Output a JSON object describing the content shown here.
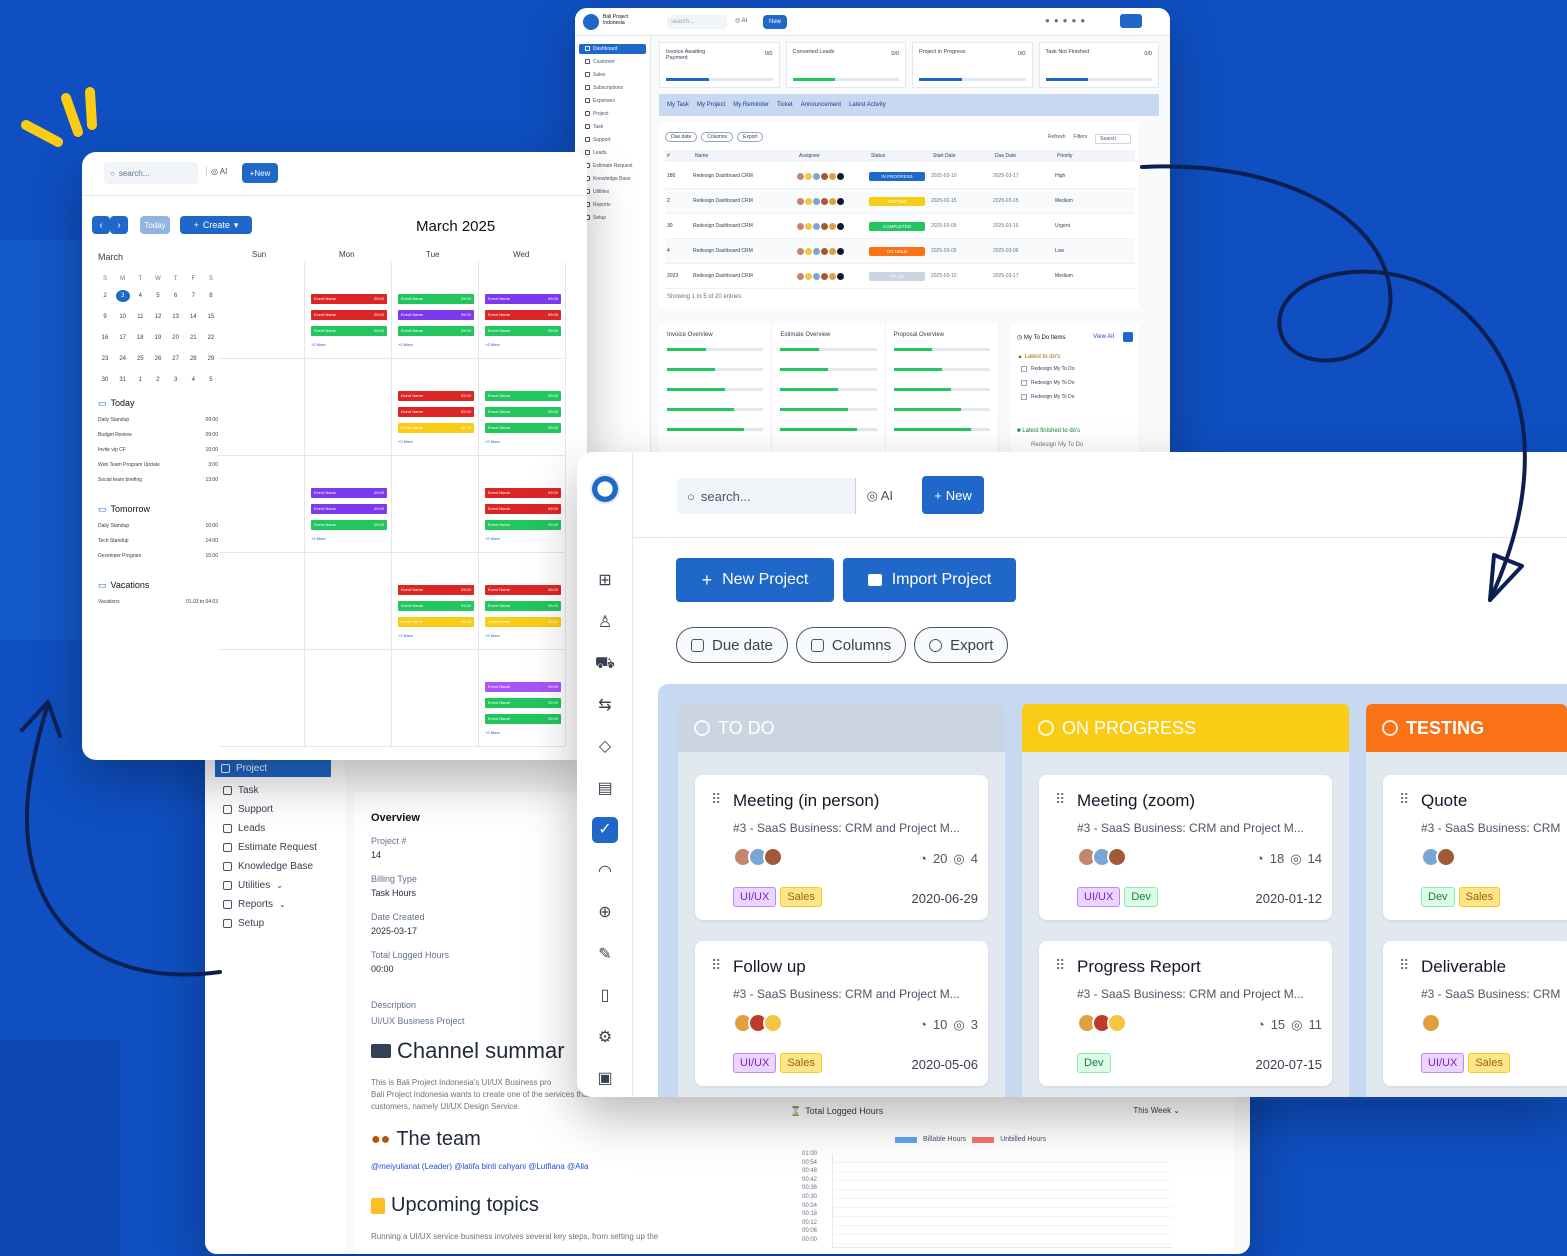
{
  "colors": {
    "background": "#0f4fc1",
    "accent": "#1f67c8",
    "todo": "#cbd5e1",
    "on_progress": "#facc15",
    "testing": "#f97316"
  },
  "report": {
    "nav": [
      {
        "label": "Project",
        "icon": "project-icon",
        "active": true
      },
      {
        "label": "Task",
        "icon": "task-icon"
      },
      {
        "label": "Support",
        "icon": "headset-icon"
      },
      {
        "label": "Leads",
        "icon": "target-icon"
      },
      {
        "label": "Estimate Request",
        "icon": "estimate-icon"
      },
      {
        "label": "Knowledge Base",
        "icon": "book-icon"
      },
      {
        "label": "Utilities",
        "icon": "utilities-icon",
        "chevron": true
      },
      {
        "label": "Reports",
        "icon": "reports-icon",
        "chevron": true
      },
      {
        "label": "Setup",
        "icon": "gear-icon"
      }
    ],
    "overview": {
      "title": "Overview",
      "project_no_label": "Project #",
      "project_no": "14",
      "billing_label": "Billing Type",
      "billing": "Task Hours",
      "date_label": "Date Created",
      "date": "2025-03-17",
      "hours_label": "Total Logged Hours",
      "hours": "00:00",
      "desc_label": "Description",
      "desc": "UI/UX Business Project"
    },
    "channel_heading": "Channel summar",
    "channel_text_1": "This is Bali Project Indonesia's UI/UX Business pro",
    "channel_text_2": "Bali Project Indonesia wants to create one of the services that we will offer to",
    "channel_text_3": "customers, namely UI/UX Design Service.",
    "team_heading": "The team",
    "team_line": "@meiyulianat (Leader) @latifa binti cahyani @Lutfiana @Alia",
    "topics_heading": "Upcoming topics",
    "topics_text": "Running a UI/UX service business involves several key steps, from setting up the",
    "chart": {
      "title": "Total Logged Hours",
      "range": "This Week",
      "legend": [
        "Billable Hours",
        "Unbilled Hours"
      ],
      "yticks": [
        "01:00",
        "00:54",
        "00:48",
        "00:42",
        "00:36",
        "00:30",
        "00:24",
        "00:18",
        "00:12",
        "00:06",
        "00:00"
      ]
    }
  },
  "dashboard": {
    "brand": "Bali Project Indonesia",
    "search": "search...",
    "ai": "AI",
    "new": "New",
    "nav": [
      "Dashboard",
      "Customer",
      "Sales",
      "Subscriptions",
      "Expenses",
      "Project",
      "Task",
      "Support",
      "Leads",
      "Estimate Request",
      "Knowledge Base",
      "Utilities",
      "Reports",
      "Setup"
    ],
    "stats": [
      {
        "label": "Invoice Awaiting Payment",
        "value": "0/0"
      },
      {
        "label": "Converted Leads",
        "value": "0/0"
      },
      {
        "label": "Project in Progress",
        "value": "0/0"
      },
      {
        "label": "Task Not Finished",
        "value": "0/0"
      }
    ],
    "tabs": [
      "My Task",
      "My Project",
      "My Reminder",
      "Ticket",
      "Announcement",
      "Latest Activity"
    ],
    "filters": [
      "Due date",
      "Columns",
      "Export"
    ],
    "table_actions": [
      "Refresh",
      "Filters",
      "Search"
    ],
    "columns": [
      "#",
      "Name",
      "Assignee",
      "Status",
      "Start Date",
      "Due Date",
      "Priority"
    ],
    "rows": [
      {
        "num": "180",
        "name": "Redesign Dashboard CRM",
        "status": "IN PROGRESS",
        "status_color": "#1f67c8",
        "start": "2025-03-10",
        "due": "2025-03-17",
        "priority": "High"
      },
      {
        "num": "2",
        "name": "Redesign Dashboard CRM",
        "status": "TESTING",
        "status_color": "#facc15",
        "start": "2025-02-15",
        "due": "2025-03-15",
        "priority": "Medium"
      },
      {
        "num": "30",
        "name": "Redesign Dashboard CRM",
        "status": "COMPLETED",
        "status_color": "#22c55e",
        "start": "2025-03-05",
        "due": "2025-03-15",
        "priority": "Urgent"
      },
      {
        "num": "4",
        "name": "Redesign Dashboard CRM",
        "status": "ON HOLD",
        "status_color": "#f97316",
        "start": "2025-03-05",
        "due": "2025-03-06",
        "priority": "Low"
      },
      {
        "num": "2023",
        "name": "Redesign Dashboard CRM",
        "status": "TO DO",
        "status_color": "#cbd5e1",
        "start": "2025-03-10",
        "due": "2025-03-17",
        "priority": "Medium"
      }
    ],
    "showing": "Showing 1 to 5 of 20 entries",
    "overviews": [
      "Invoice Overview",
      "Estimate Overview",
      "Proposal Overview"
    ],
    "todo_title": "My To Do Items",
    "todo_view": "View All",
    "todo_latest": "Latest to do's",
    "todo_done": "Latest finished to do's",
    "todo_item": "Redesign My To Do"
  },
  "calendar": {
    "search": "search...",
    "ai": "AI",
    "new": "New",
    "today_btn": "Today",
    "create_btn": "Create",
    "title": "March 2025",
    "days": [
      "Sun",
      "Mon",
      "Tue",
      "Wed"
    ],
    "mini_month": "March",
    "mini_weekdays": [
      "S",
      "M",
      "T",
      "W",
      "T",
      "F",
      "S"
    ],
    "mini_rows": [
      [
        "2",
        "3",
        "4",
        "5",
        "6",
        "7",
        "8"
      ],
      [
        "9",
        "10",
        "11",
        "12",
        "13",
        "14",
        "15"
      ],
      [
        "16",
        "17",
        "18",
        "19",
        "20",
        "21",
        "22"
      ],
      [
        "23",
        "24",
        "25",
        "26",
        "27",
        "28",
        "29"
      ],
      [
        "30",
        "31",
        "1",
        "2",
        "3",
        "4",
        "5"
      ]
    ],
    "sections": [
      {
        "title": "Today",
        "items": [
          [
            "Daily Standup",
            "09:00"
          ],
          [
            "Budget Review",
            "09:00"
          ],
          [
            "Invite vip CF",
            "10:00"
          ],
          [
            "Web Team Program Update",
            "3:00"
          ],
          [
            "Social team briefing",
            "13:00"
          ]
        ]
      },
      {
        "title": "Tomorrow",
        "items": [
          [
            "Daily Standup",
            "10:00"
          ],
          [
            "Tech Standup",
            "14:00"
          ],
          [
            "Developer Program",
            "15:00"
          ]
        ]
      },
      {
        "title": "Vacations",
        "items": [
          [
            "Vacations",
            "01.03 to 04.03"
          ]
        ]
      }
    ],
    "event_label": "Event Name",
    "event_time": "09:00",
    "more": "+2 More"
  },
  "kanban": {
    "search": "search...",
    "ai": "AI",
    "new": "New",
    "new_project": "New Project",
    "import_project": "Import Project",
    "filters": [
      "Due date",
      "Columns",
      "Export"
    ],
    "columns": [
      {
        "title": "TO DO",
        "color": "#cbd5e1",
        "text": "#ffffff",
        "cards": [
          {
            "title": "Meeting (in person)",
            "sub": "#3 - SaaS Business: CRM and Project M...",
            "comments": "20",
            "views": "4",
            "tags": [
              "UI/UX",
              "Sales"
            ],
            "date": "2020-06-29",
            "avatars": [
              "#c2876a",
              "#7aa6d6",
              "#a05a3a"
            ]
          },
          {
            "title": "Follow up",
            "sub": "#3 - SaaS Business: CRM and Project M...",
            "comments": "10",
            "views": "3",
            "tags": [
              "UI/UX",
              "Sales"
            ],
            "date": "2020-05-06",
            "avatars": [
              "#e0a040",
              "#c0392b",
              "#f5c542"
            ]
          }
        ]
      },
      {
        "title": "ON PROGRESS",
        "color": "#facc15",
        "text": "#ffffff",
        "cards": [
          {
            "title": "Meeting (zoom)",
            "sub": "#3 - SaaS Business: CRM and Project M...",
            "comments": "18",
            "views": "14",
            "tags": [
              "UI/UX",
              "Dev"
            ],
            "date": "2020-01-12",
            "avatars": [
              "#c2876a",
              "#7aa6d6",
              "#a05a3a"
            ]
          },
          {
            "title": "Progress Report",
            "sub": "#3 - SaaS Business: CRM and Project M...",
            "comments": "15",
            "views": "11",
            "tags": [
              "Dev"
            ],
            "date": "2020-07-15",
            "avatars": [
              "#e0a040",
              "#c0392b",
              "#f5c542"
            ]
          }
        ]
      },
      {
        "title": "TESTING",
        "color": "#f97316",
        "text": "#ffffff",
        "cards": [
          {
            "title": "Quote",
            "sub": "#3 - SaaS Business: CRM",
            "tags": [
              "Dev",
              "Sales"
            ],
            "avatars": [
              "#7aa6d6",
              "#a05a3a"
            ]
          },
          {
            "title": "Deliverable",
            "sub": "#3 - SaaS Business: CRM",
            "tags": [
              "UI/UX",
              "Sales"
            ],
            "avatars": [
              "#e0a040"
            ]
          }
        ]
      }
    ],
    "side_icons": [
      "grid-icon",
      "user-icon",
      "cart-icon",
      "repeat-icon",
      "bag-icon",
      "file-icon",
      "task-check-icon",
      "headset-icon",
      "target-icon",
      "estimate-icon",
      "book-icon",
      "utilities-icon",
      "reports-icon"
    ]
  }
}
